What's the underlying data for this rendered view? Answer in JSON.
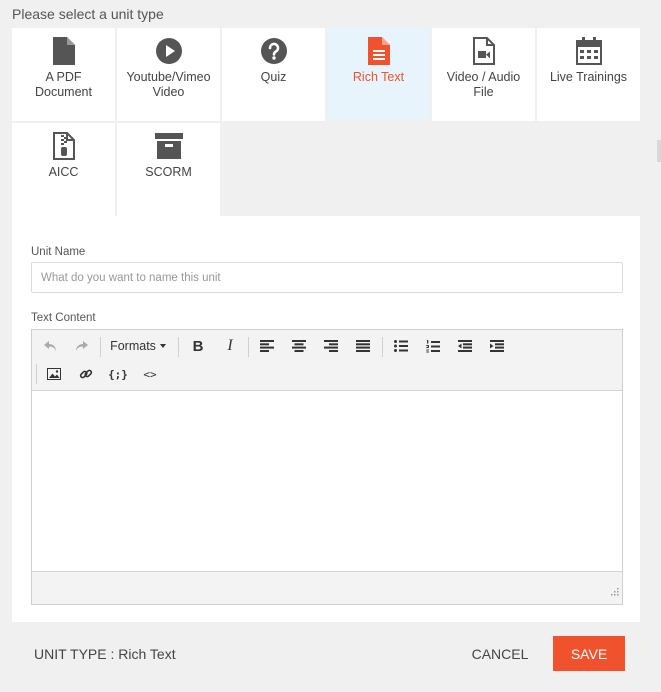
{
  "heading": "Please select a unit type",
  "unit_types": [
    {
      "label": "A PDF Document",
      "icon": "pdf-document-icon"
    },
    {
      "label": "Youtube/Vimeo Video",
      "icon": "play-circle-icon"
    },
    {
      "label": "Quiz",
      "icon": "question-circle-icon"
    },
    {
      "label": "Rich Text",
      "icon": "rich-text-file-icon",
      "selected": true
    },
    {
      "label": "Video / Audio File",
      "icon": "video-file-icon"
    },
    {
      "label": "Live Trainings",
      "icon": "calendar-icon"
    },
    {
      "label": "AICC",
      "icon": "zip-file-icon"
    },
    {
      "label": "SCORM",
      "icon": "archive-box-icon"
    }
  ],
  "form": {
    "unit_name_label": "Unit Name",
    "unit_name_placeholder": "What do you want to name this unit",
    "unit_name_value": "",
    "text_content_label": "Text Content"
  },
  "toolbar": {
    "formats_label": "Formats",
    "bold_label": "B",
    "italic_label": "I",
    "code_label": "<>",
    "variable_label": "{;}"
  },
  "footer": {
    "unit_type_text": "UNIT TYPE : Rich Text",
    "cancel_label": "CANCEL",
    "save_label": "SAVE"
  },
  "colors": {
    "accent": "#f0522e",
    "selected_tile_bg": "#e7f4fb",
    "icon_gray": "#555555"
  }
}
